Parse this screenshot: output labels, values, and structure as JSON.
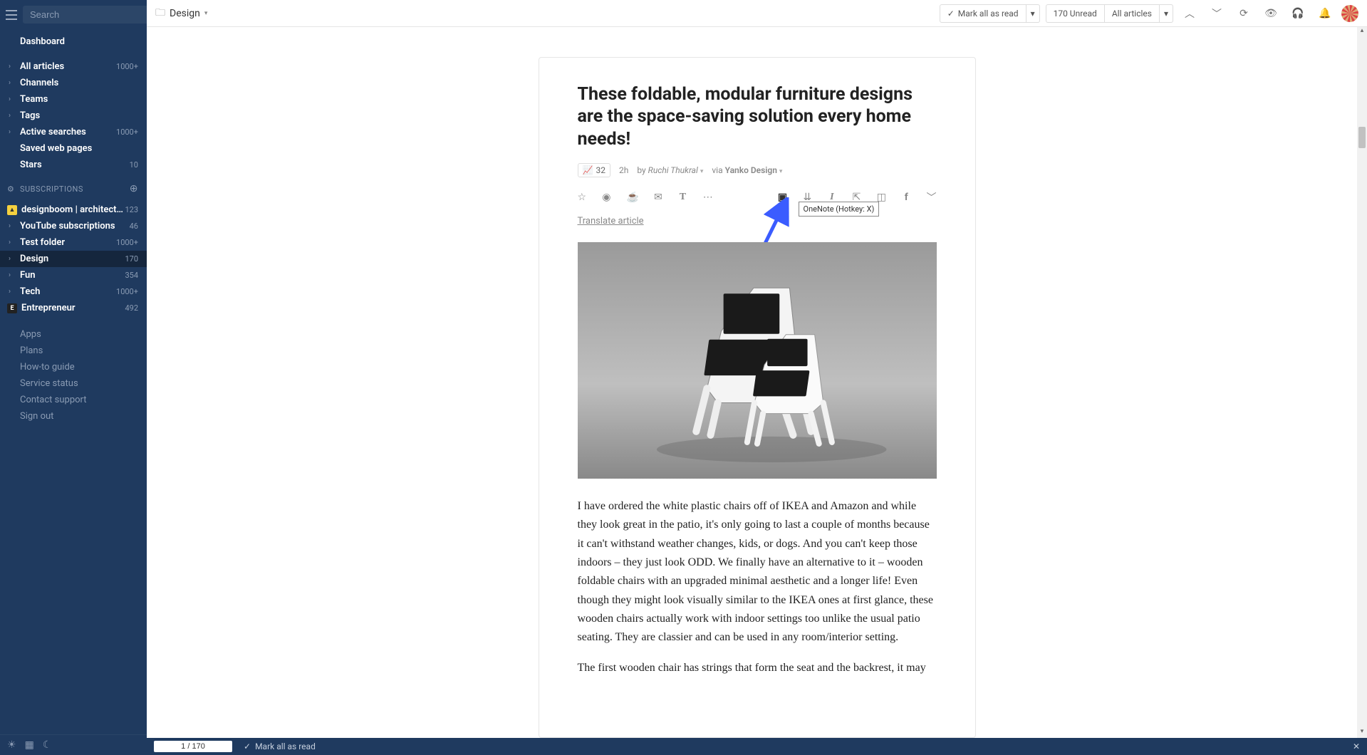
{
  "search": {
    "placeholder": "Search"
  },
  "sidebar": {
    "dashboard": "Dashboard",
    "main_items": [
      {
        "label": "All articles",
        "count": "1000+",
        "chevron": true,
        "bold": true
      },
      {
        "label": "Channels",
        "count": "",
        "chevron": true,
        "bold": true
      },
      {
        "label": "Teams",
        "count": "",
        "chevron": true,
        "bold": true
      },
      {
        "label": "Tags",
        "count": "",
        "chevron": true,
        "bold": true
      },
      {
        "label": "Active searches",
        "count": "1000+",
        "chevron": true,
        "bold": true
      },
      {
        "label": "Saved web pages",
        "count": "",
        "chevron": false,
        "bold": true
      },
      {
        "label": "Stars",
        "count": "10",
        "chevron": false,
        "bold": true
      }
    ],
    "subs_header": "SUBSCRIPTIONS",
    "subscriptions": [
      {
        "label": "designboom | architecture & …",
        "count": "123",
        "icon": "yellow",
        "bold": true
      },
      {
        "label": "YouTube subscriptions",
        "count": "46",
        "icon": "",
        "bold": true
      },
      {
        "label": "Test folder",
        "count": "1000+",
        "icon": "",
        "bold": true
      },
      {
        "label": "Design",
        "count": "170",
        "icon": "",
        "active": true,
        "bold": true
      },
      {
        "label": "Fun",
        "count": "354",
        "icon": "",
        "bold": true
      },
      {
        "label": "Tech",
        "count": "1000+",
        "icon": "",
        "bold": true
      },
      {
        "label": "Entrepreneur",
        "count": "492",
        "icon": "black",
        "icon_text": "E",
        "bold": true
      }
    ],
    "footer": [
      "Apps",
      "Plans",
      "How-to guide",
      "Service status",
      "Contact support",
      "Sign out"
    ]
  },
  "topbar": {
    "breadcrumb": "Design",
    "mark_all": "Mark all as read",
    "unread": "170 Unread",
    "filter": "All articles"
  },
  "article": {
    "title": "These foldable, modular furniture designs are the space-saving solution every home needs!",
    "trend_count": "32",
    "age": "2h",
    "by_label": "by",
    "author": "Ruchi Thukral",
    "via_label": "via",
    "source": "Yanko Design",
    "tooltip": "OneNote (Hotkey: X)",
    "translate": "Translate article",
    "body_p1": "I have ordered the white plastic chairs off of IKEA and Amazon and while they look great in the patio, it's only going to last a couple of months because it can't withstand weather changes, kids, or dogs. And you can't keep those indoors – they just look ODD. We finally have an alternative to it – wooden foldable chairs with an upgraded minimal aesthetic and a longer life! Even though they might look visually similar to the IKEA ones at first glance, these wooden chairs actually work with indoor settings too unlike the usual patio seating. They are classier and can be used in any room/interior setting.",
    "body_p2": "The first wooden chair has strings that form the seat and the backrest, it may"
  },
  "bottombar": {
    "page": "1 / 170",
    "mark_all": "Mark all as read"
  }
}
